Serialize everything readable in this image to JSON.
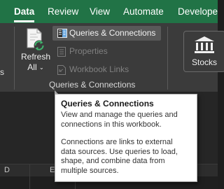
{
  "tabs": [
    {
      "label": "Data",
      "active": true
    },
    {
      "label": "Review",
      "active": false
    },
    {
      "label": "View",
      "active": false
    },
    {
      "label": "Automate",
      "active": false
    },
    {
      "label": "Develope",
      "active": false
    }
  ],
  "ribbon": {
    "left_fragment": "s",
    "refresh": {
      "line1": "Refresh",
      "line2": "All",
      "caret": "⌄",
      "icon": "refresh-all-icon"
    },
    "queries_group": {
      "items": [
        {
          "label": "Queries & Connections",
          "enabled": true,
          "highlighted": true,
          "icon": "queries-connections-icon"
        },
        {
          "label": "Properties",
          "enabled": false,
          "icon": "properties-icon"
        },
        {
          "label": "Workbook Links",
          "enabled": false,
          "icon": "workbook-links-icon"
        }
      ],
      "group_label": "Queries & Connections"
    },
    "stocks": {
      "label": "Stocks",
      "icon": "bank-building-icon"
    }
  },
  "sheet": {
    "column_letters": [
      "D",
      "E"
    ]
  },
  "tooltip": {
    "title": "Queries & Connections",
    "para1_lines": [
      "View and manage the queries and",
      "connections in this workbook."
    ],
    "para2_lines": [
      "Connections are links to external",
      "data sources. Use queries to load,",
      "shape, and combine data from",
      "multiple sources."
    ]
  },
  "colors": {
    "tab_bar": "#217346",
    "ribbon": "#3b3b3b",
    "highlight": "#595959",
    "tooltip_bg": "#ffffff"
  }
}
